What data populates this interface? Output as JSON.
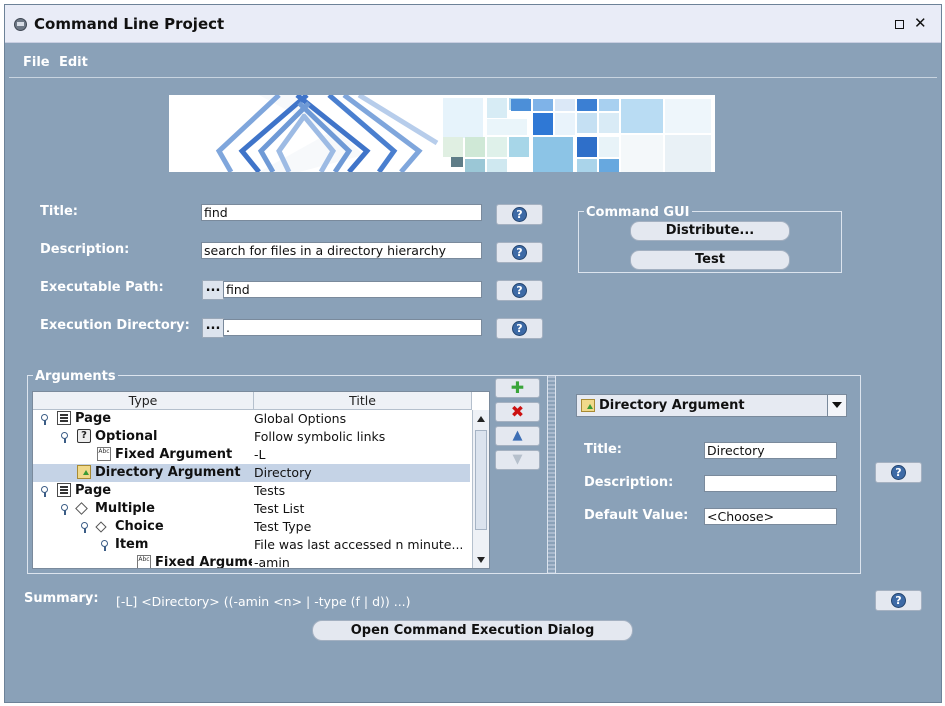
{
  "window": {
    "title": "Command Line Project",
    "app_icon": "app-icon",
    "maximize_icon": "maximize-icon",
    "close_icon": "close-icon",
    "close_glyph": "✕"
  },
  "menu": {
    "file": "File",
    "edit": "Edit"
  },
  "form": {
    "title_label": "Title:",
    "title_value": "find",
    "description_label": "Description:",
    "description_value": "search for files in a directory hierarchy",
    "exec_path_label": "Executable Path:",
    "exec_path_value": "find",
    "exec_dir_label": "Execution Directory:",
    "exec_dir_value": ".",
    "browse_label": "...",
    "help_glyph": "?"
  },
  "command_gui": {
    "legend": "Command   GUI",
    "distribute_label": "Distribute...",
    "test_label": "Test"
  },
  "arguments": {
    "legend": "Arguments",
    "columns": [
      "Type",
      "Title"
    ],
    "rows": [
      {
        "type": "Page",
        "title": "Global Options",
        "icon": "page-icon",
        "indent": 0,
        "key": true
      },
      {
        "type": "Optional",
        "title": "Follow symbolic links",
        "icon": "optional-icon",
        "indent": 1,
        "key": true
      },
      {
        "type": "Fixed Argument",
        "title": "-L",
        "icon": "fixed-argument-icon",
        "indent": 2,
        "key": false
      },
      {
        "type": "Directory Argument",
        "title": "Directory",
        "icon": "directory-argument-icon",
        "indent": 1,
        "key": false,
        "selected": true
      },
      {
        "type": "Page",
        "title": "Tests",
        "icon": "page-icon",
        "indent": 0,
        "key": true
      },
      {
        "type": "Multiple",
        "title": "Test List",
        "icon": "multiple-icon",
        "indent": 1,
        "key": true
      },
      {
        "type": "Choice",
        "title": "Test Type",
        "icon": "choice-icon",
        "indent": 2,
        "key": true
      },
      {
        "type": "Item",
        "title": "File was last accessed n minute...",
        "icon": "item-icon",
        "indent": 3,
        "key": true
      },
      {
        "type": "Fixed Argume",
        "title": "-amin",
        "icon": "fixed-argument-icon",
        "indent": 4,
        "key": false
      }
    ],
    "toolbar": {
      "add_glyph": "✚",
      "remove_glyph": "✖",
      "up_glyph": "▲",
      "down_glyph": "▼"
    }
  },
  "detail": {
    "combo_value": "Directory Argument",
    "title_label": "Title:",
    "title_value": "Directory",
    "description_label": "Description:",
    "description_value": "",
    "default_label": "Default Value:",
    "default_value": "<Choose>"
  },
  "summary": {
    "label": "Summary:",
    "value": "[-L] <Directory> ((-amin <n> | -type (f | d)) ...)"
  },
  "open_dialog_label": "Open Command Execution Dialog",
  "colors": {
    "background": "#8aa1b8",
    "titlebar": "#e9ecf7",
    "selection": "#c5d3e6",
    "help": "#3d6aa6",
    "add": "#3aa53a",
    "remove": "#cc1111"
  }
}
